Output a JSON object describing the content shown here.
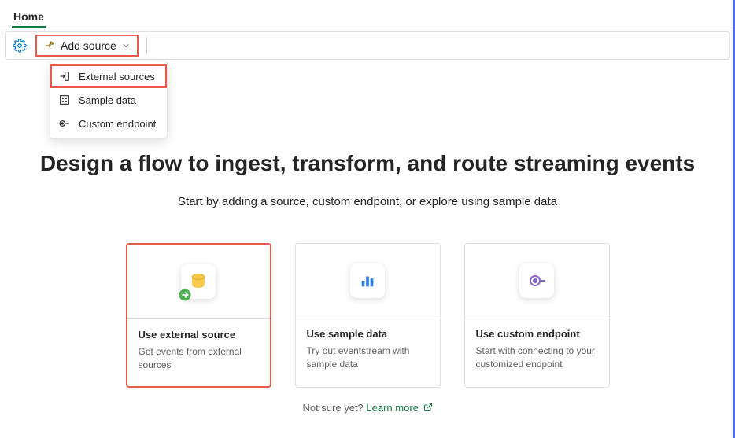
{
  "tab": {
    "label": "Home"
  },
  "toolbar": {
    "add_source_label": "Add source"
  },
  "dropdown": {
    "items": [
      {
        "label": "External sources"
      },
      {
        "label": "Sample data"
      },
      {
        "label": "Custom endpoint"
      }
    ]
  },
  "main": {
    "heading": "Design a flow to ingest, transform, and route streaming events",
    "subtitle": "Start by adding a source, custom endpoint, or explore using sample data"
  },
  "cards": [
    {
      "title": "Use external source",
      "desc": "Get events from external sources"
    },
    {
      "title": "Use sample data",
      "desc": "Try out eventstream with sample data"
    },
    {
      "title": "Use custom endpoint",
      "desc": "Start with connecting to your customized endpoint"
    }
  ],
  "footer": {
    "prompt": "Not sure yet? ",
    "learn_more": "Learn more"
  }
}
